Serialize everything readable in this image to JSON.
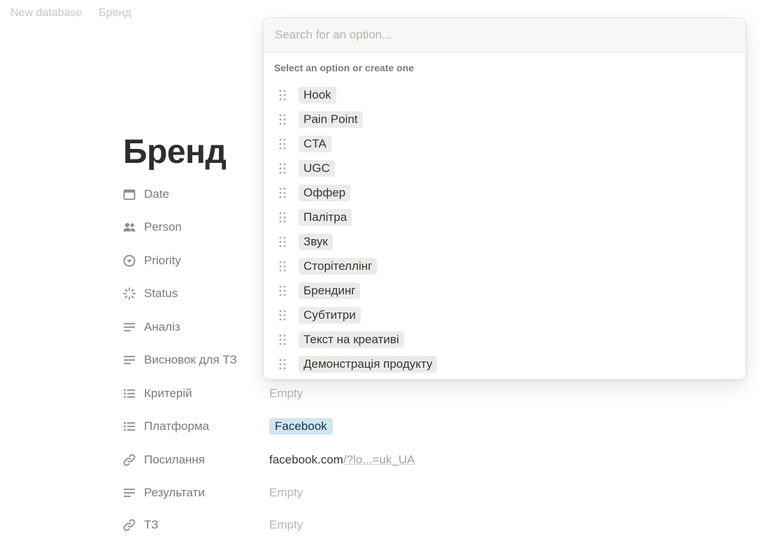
{
  "breadcrumb": {
    "items": [
      "New database",
      "Бренд"
    ]
  },
  "page": {
    "title": "Бренд"
  },
  "properties": [
    {
      "name": "Date",
      "icon": "calendar-icon",
      "value": ""
    },
    {
      "name": "Person",
      "icon": "people-icon",
      "value": ""
    },
    {
      "name": "Priority",
      "icon": "priority-icon",
      "value": ""
    },
    {
      "name": "Status",
      "icon": "status-icon",
      "value": ""
    },
    {
      "name": "Аналіз",
      "icon": "text-lines-icon",
      "value": ""
    },
    {
      "name": "Висновок для ТЗ",
      "icon": "text-lines-icon",
      "value": ""
    },
    {
      "name": "Критерій",
      "icon": "multi-select-icon",
      "value": "Empty"
    },
    {
      "name": "Платформа",
      "icon": "multi-select-icon",
      "value": "Facebook"
    },
    {
      "name": "Посилання",
      "icon": "link-icon",
      "value_main": "facebook.com",
      "value_rest": "/?lo...=uk_UA"
    },
    {
      "name": "Результати",
      "icon": "text-lines-icon",
      "value": "Empty"
    },
    {
      "name": "ТЗ",
      "icon": "link-icon",
      "value": "Empty"
    }
  ],
  "popup": {
    "search_placeholder": "Search for an option...",
    "heading": "Select an option or create one",
    "options": [
      "Hook",
      "Pain Point",
      "CTA",
      "UGC",
      "Оффер",
      "Палітра",
      "Звук",
      "Сторітеллінг",
      "Брендинг",
      "Субтитри",
      "Текст на креативі",
      "Демонстрація продукту"
    ]
  },
  "colors": {
    "tag_gray": "#ecebe9",
    "tag_blue": "#d3e5ef",
    "text": "#37352f",
    "muted": "#b7b4ae"
  }
}
